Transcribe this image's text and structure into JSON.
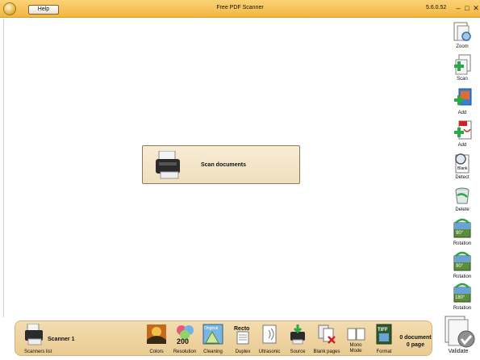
{
  "titlebar": {
    "help_label": "Help",
    "title": "Free PDF Scanner",
    "version": "5.6.0.52",
    "minimize": "–",
    "maximize": "□",
    "close": "✕"
  },
  "main": {
    "scan_card_label": "Scan documents"
  },
  "right_toolbar": [
    {
      "label": "Zoom",
      "icon": "zoom-icon"
    },
    {
      "label": "Scan",
      "icon": "scan-add-icon"
    },
    {
      "label": "Add",
      "icon": "add-image-icon"
    },
    {
      "label": "Add",
      "icon": "add-pdf-icon"
    },
    {
      "label": "Detect",
      "icon": "blank-detect-icon"
    },
    {
      "label": "Delete",
      "icon": "trash-icon"
    },
    {
      "label": "Rotation",
      "icon": "rotate-90-left-icon",
      "badge": "90°"
    },
    {
      "label": "Rotation",
      "icon": "rotate-90-right-icon",
      "badge": "90°"
    },
    {
      "label": "Rotation",
      "icon": "rotate-180-icon",
      "badge": "180°"
    }
  ],
  "bottom_bar": {
    "scanner_name": "Scanner 1",
    "scanners_list_label": "Scanners list",
    "tools": [
      {
        "label": "Colors",
        "icon": "colors-icon"
      },
      {
        "label": "Resolution",
        "icon": "resolution-icon",
        "value": "200"
      },
      {
        "label": "Cleaning",
        "icon": "cleaning-icon",
        "value": "Original"
      },
      {
        "label": "Duplex",
        "icon": "duplex-icon",
        "value": "Recto"
      },
      {
        "label": "Ultrasonic",
        "icon": "ultrasonic-icon"
      },
      {
        "label": "Source",
        "icon": "source-icon"
      },
      {
        "label": "Blank pages",
        "icon": "blank-pages-icon"
      },
      {
        "label": "Mono\nMode",
        "icon": "mono-mode-icon"
      },
      {
        "label": "Format",
        "icon": "format-icon",
        "value": "TIFF"
      }
    ],
    "doc_count": "0 document",
    "page_count": "0 page"
  },
  "validate_label": "Validate"
}
